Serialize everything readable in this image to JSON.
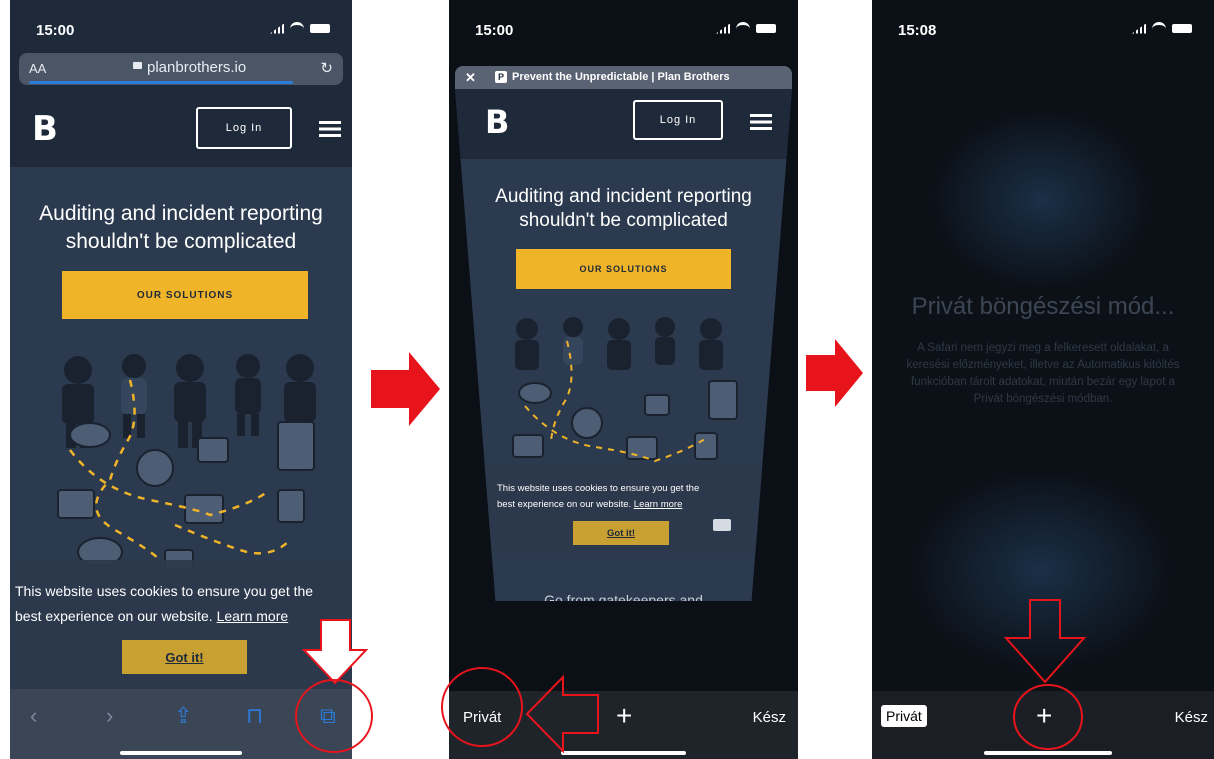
{
  "screens": [
    {
      "time": "15:00",
      "url_bar": {
        "text_size": "AA",
        "url": "planbrothers.io"
      },
      "site": {
        "logo": "B",
        "login": "Log In",
        "headline_line1": "Auditing and incident reporting",
        "headline_line2": "shouldn't be complicated",
        "cta": "OUR SOLUTIONS"
      },
      "cookie": {
        "line1": "This website uses cookies to ensure you get the",
        "line2": "best experience on our website.",
        "learn_more": "Learn more",
        "got_it": "Got it!"
      }
    },
    {
      "time": "15:00",
      "tab_title": "Prevent the Unpredictable | Plan Brothers",
      "tab_favicon": "P",
      "site": {
        "logo": "B",
        "login": "Log In",
        "headline_line1": "Auditing and incident reporting",
        "headline_line2": "shouldn't be complicated",
        "cta": "OUR SOLUTIONS",
        "bottom_text": "Go from gatekeepers and"
      },
      "cookie": {
        "line1": "This website uses cookies to ensure you get the",
        "line2": "best experience on our website.",
        "learn_more": "Learn more",
        "got_it": "Got it!"
      },
      "toolbar": {
        "private": "Privát",
        "add": "+",
        "done": "Kész"
      }
    },
    {
      "time": "15:08",
      "private_title": "Privát böngészési mód...",
      "private_body": "A Safari nem jegyzi meg a felkeresett oldalakat, a keresési előzményeket, illetve az Automatikus kitöltés funkcióban tárolt adatokat, miután bezár egy lapot a Privát böngészési módban.",
      "toolbar": {
        "private": "Privát",
        "add": "+",
        "done": "Kész"
      }
    }
  ],
  "colors": {
    "accent": "#f0b429",
    "annotation": "#e8141c",
    "link": "#2d7bd8"
  }
}
